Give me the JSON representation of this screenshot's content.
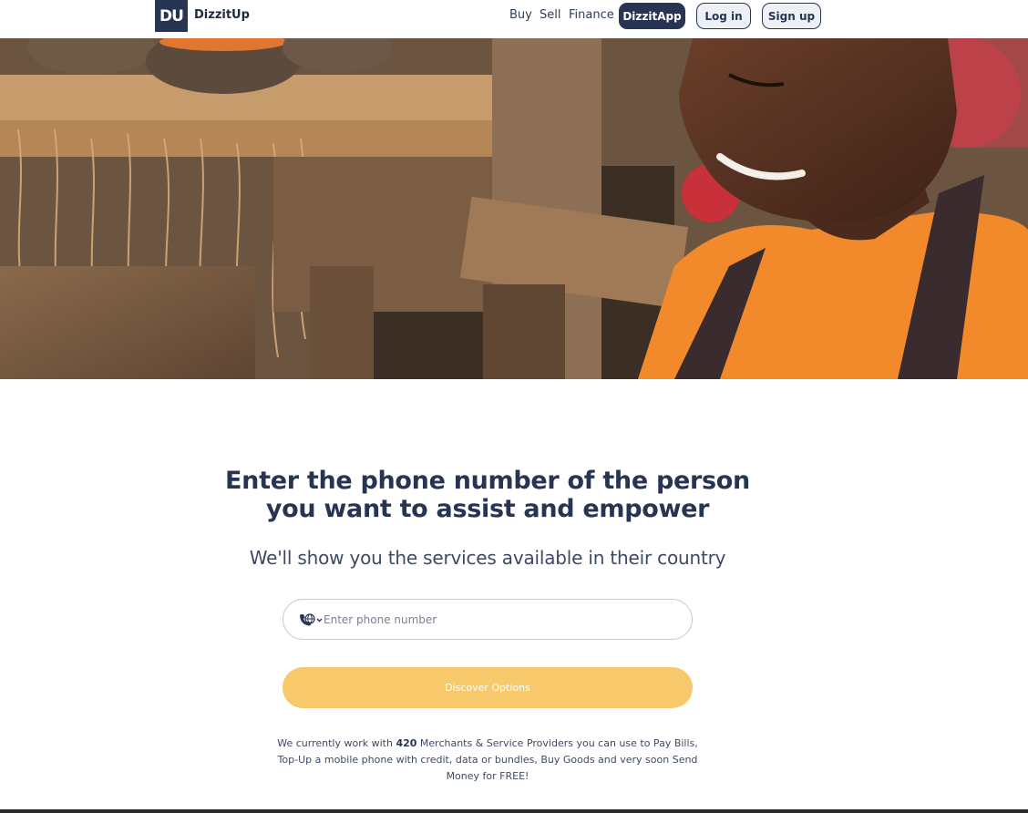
{
  "header": {
    "logo_text": "DU",
    "brand": "DizzitUp",
    "nav": {
      "buy": "Buy",
      "sell": "Sell",
      "finance": "Finance"
    },
    "app_button": "DizzitApp",
    "login_button": "Log in",
    "signup_button": "Sign up"
  },
  "main": {
    "headline_line1": "Enter the phone number of the person",
    "headline_line2": "you want to assist and empower",
    "subhead": "We'll show you the services available in their country",
    "phone_placeholder": "Enter phone number",
    "phone_value": "",
    "discover_button": "Discover Options",
    "info_pre": "We currently work with ",
    "info_count": "420",
    "info_post": " Merchants & Service Providers you can use to Pay Bills, Top-Up a mobile phone with credit, data or bundles, Buy Goods and very soon Send Money for FREE!"
  },
  "icons": {
    "phone_country": "phone-globe-icon",
    "dropdown": "chevron-down-icon"
  },
  "colors": {
    "primary": "#273552",
    "accent": "#f7c96a",
    "light_button_bg": "#edf0f5"
  }
}
